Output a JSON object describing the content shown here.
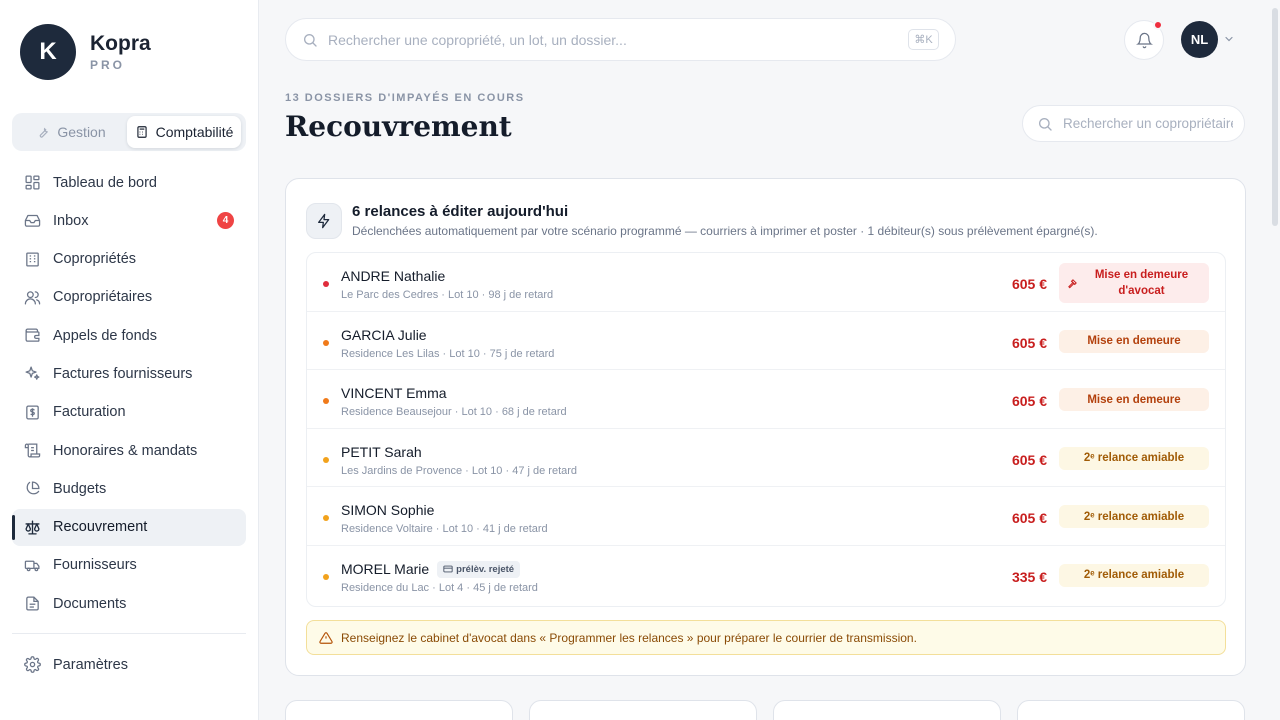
{
  "brand": {
    "initial": "K",
    "name": "Kopra",
    "tier": "PRO"
  },
  "mode_switch": {
    "gestion": "Gestion",
    "comptabilite": "Comptabilité"
  },
  "sidebar": {
    "items": [
      {
        "label": "Tableau de bord",
        "icon": "dashboard-icon"
      },
      {
        "label": "Inbox",
        "icon": "inbox-icon",
        "badge": "4"
      },
      {
        "label": "Copropriétés",
        "icon": "building-icon"
      },
      {
        "label": "Copropriétaires",
        "icon": "users-icon"
      },
      {
        "label": "Appels de fonds",
        "icon": "wallet-icon"
      },
      {
        "label": "Factures fournisseurs",
        "icon": "sparkles-icon"
      },
      {
        "label": "Facturation",
        "icon": "receipt-dollar-icon"
      },
      {
        "label": "Honoraires & mandats",
        "icon": "scroll-icon"
      },
      {
        "label": "Budgets",
        "icon": "pie-chart-icon"
      },
      {
        "label": "Recouvrement",
        "icon": "scale-icon",
        "active": true
      },
      {
        "label": "Fournisseurs",
        "icon": "truck-icon"
      },
      {
        "label": "Documents",
        "icon": "document-icon"
      }
    ],
    "settings": "Paramètres"
  },
  "topbar": {
    "search_placeholder": "Rechercher une copropriété, un lot, un dossier...",
    "shortcut": "⌘K",
    "avatar_initials": "NL"
  },
  "page": {
    "eyebrow": "13 DOSSIERS D'IMPAYÉS EN COURS",
    "title": "Recouvrement",
    "owner_search_placeholder": "Rechercher un copropriétaire"
  },
  "card": {
    "title": "6 relances à éditer aujourd'hui",
    "subtitle": "Déclenchées automatiquement par votre scénario programmé — courriers à imprimer et poster · 1 débiteur(s) sous prélèvement épargné(s).",
    "rows": [
      {
        "name": "ANDRE Nathalie",
        "meta": "Le Parc des Cedres · Lot 10 · 98 j de retard",
        "amount": "605 €",
        "action": "Mise en demeure d'avocat",
        "level": "avocat",
        "dot": "#e02d3c"
      },
      {
        "name": "GARCIA Julie",
        "meta": "Residence Les Lilas · Lot 10 · 75 j de retard",
        "amount": "605 €",
        "action": "Mise en demeure",
        "level": "demeure",
        "dot": "#f07a1a"
      },
      {
        "name": "VINCENT Emma",
        "meta": "Residence Beausejour · Lot 10 · 68 j de retard",
        "amount": "605 €",
        "action": "Mise en demeure",
        "level": "demeure",
        "dot": "#f07a1a"
      },
      {
        "name": "PETIT Sarah",
        "meta": "Les Jardins de Provence · Lot 10 · 47 j de retard",
        "amount": "605 €",
        "action": "2ᵉ relance amiable",
        "level": "amiable",
        "dot": "#f2a21c"
      },
      {
        "name": "SIMON Sophie",
        "meta": "Residence Voltaire · Lot 10 · 41 j de retard",
        "amount": "605 €",
        "action": "2ᵉ relance amiable",
        "level": "amiable",
        "dot": "#f2a21c"
      },
      {
        "name": "MOREL Marie",
        "tag": "prélèv. rejeté",
        "meta": "Residence du Lac · Lot 4 · 45 j de retard",
        "amount": "335 €",
        "action": "2ᵉ relance amiable",
        "level": "amiable",
        "dot": "#f2a21c"
      }
    ],
    "alert": "Renseignez le cabinet d'avocat dans « Programmer les relances » pour préparer le courrier de transmission."
  }
}
